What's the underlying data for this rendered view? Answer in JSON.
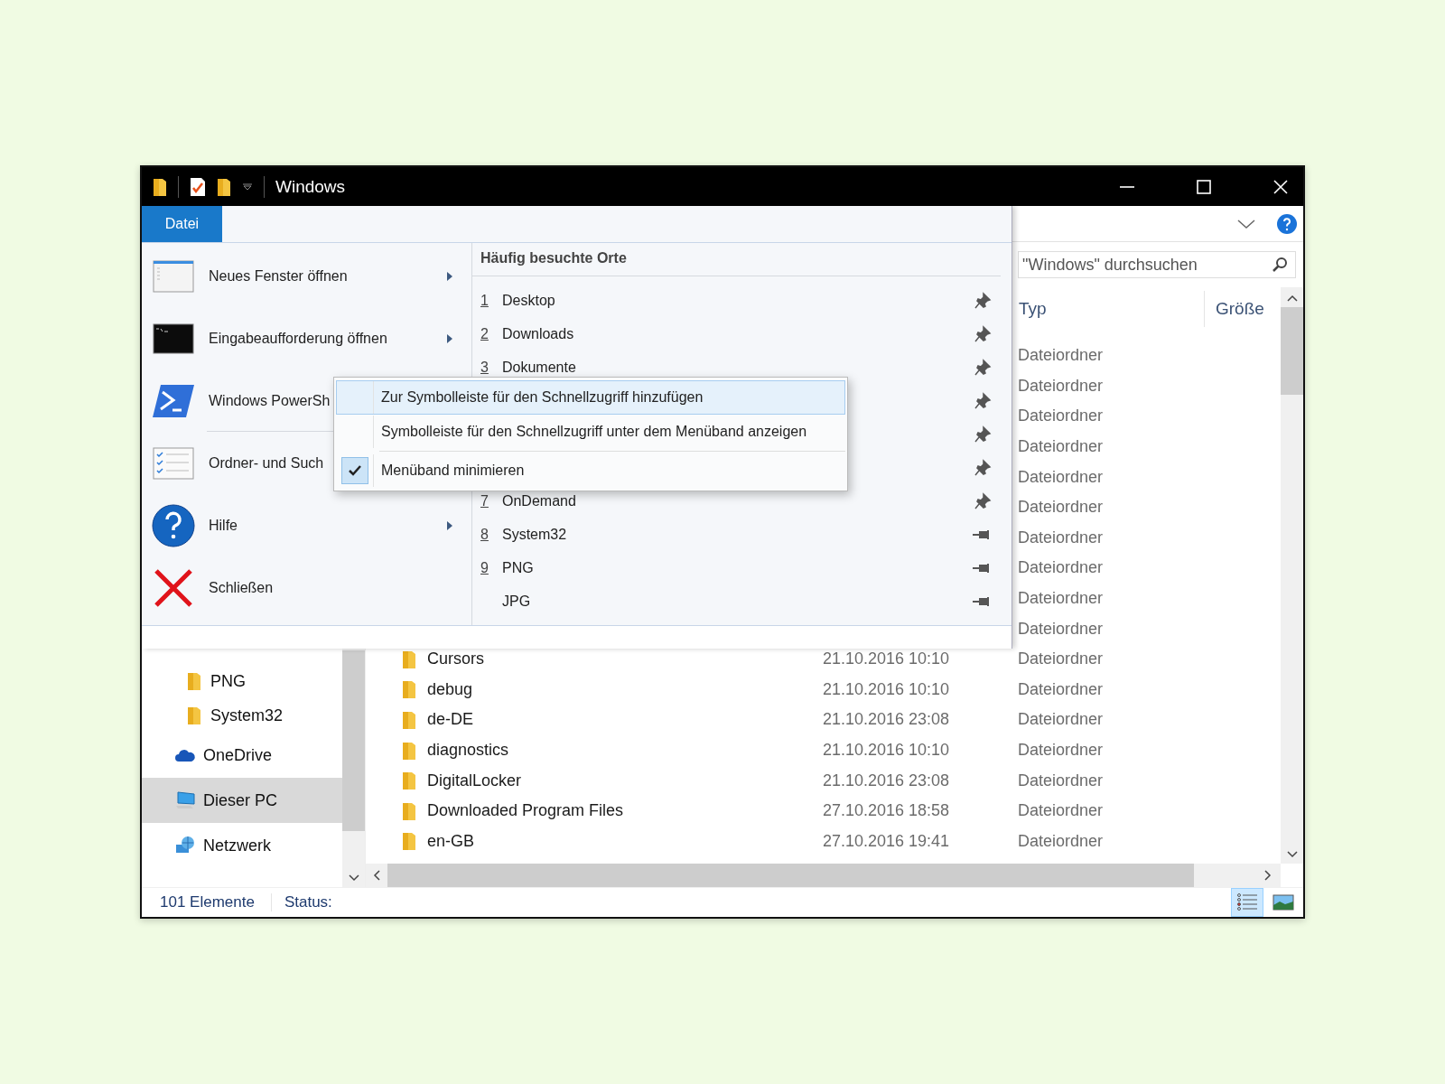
{
  "window": {
    "title": "Windows"
  },
  "search": {
    "placeholder": "\"Windows\" durchsuchen"
  },
  "file_menu": {
    "tab": "Datei",
    "commands": [
      {
        "label": "Neues Fenster öffnen",
        "submenu": true
      },
      {
        "label": "Eingabeaufforderung öffnen",
        "submenu": true
      },
      {
        "label": "Windows PowerSh",
        "submenu": false
      },
      {
        "label": "Ordner- und Such",
        "submenu": false
      },
      {
        "label": "Hilfe",
        "submenu": true
      },
      {
        "label": "Schließen",
        "submenu": false
      }
    ],
    "recent_title": "Häufig besuchte Orte",
    "recent_places": [
      {
        "number": "1",
        "name": "Desktop",
        "pinned": true
      },
      {
        "number": "2",
        "name": "Downloads",
        "pinned": true
      },
      {
        "number": "3",
        "name": "Dokumente",
        "pinned": true
      },
      {
        "pinned": true
      },
      {
        "pinned": true
      },
      {
        "pinned": true
      },
      {
        "number": "7",
        "name": "OnDemand",
        "pinned": true
      },
      {
        "number": "8",
        "name": "System32",
        "pinned": false
      },
      {
        "number": "9",
        "name": "PNG",
        "pinned": false
      },
      {
        "name": "JPG",
        "pinned": false
      }
    ]
  },
  "context_menu": {
    "items": [
      {
        "label": "Zur Symbolleiste für den Schnellzugriff hinzufügen",
        "selected": true,
        "checked": false
      },
      {
        "label": "Symbolleiste für den Schnellzugriff unter dem Menüband anzeigen",
        "selected": false,
        "checked": false
      },
      {
        "label": "Menüband minimieren",
        "selected": false,
        "checked": true
      }
    ]
  },
  "navigation": {
    "items": [
      {
        "kind": "folder",
        "label": "PNG",
        "selected": false
      },
      {
        "kind": "folder",
        "label": "System32",
        "selected": false
      },
      {
        "kind": "cloud",
        "label": "OneDrive",
        "selected": false
      },
      {
        "kind": "computer",
        "label": "Dieser PC",
        "selected": true
      },
      {
        "kind": "network",
        "label": "Netzwerk",
        "selected": false
      }
    ]
  },
  "columns": [
    {
      "label": "Typ"
    },
    {
      "label": "Größe"
    }
  ],
  "rows": [
    {
      "type": "Dateiordner"
    },
    {
      "type": "Dateiordner"
    },
    {
      "type": "Dateiordner"
    },
    {
      "type": "Dateiordner"
    },
    {
      "type": "Dateiordner"
    },
    {
      "type": "Dateiordner"
    },
    {
      "type": "Dateiordner"
    },
    {
      "type": "Dateiordner"
    },
    {
      "type": "Dateiordner"
    },
    {
      "type": "Dateiordner"
    },
    {
      "name": "Cursors",
      "date": "21.10.2016 10:10",
      "type": "Dateiordner"
    },
    {
      "name": "debug",
      "date": "21.10.2016 10:10",
      "type": "Dateiordner"
    },
    {
      "name": "de-DE",
      "date": "21.10.2016 23:08",
      "type": "Dateiordner"
    },
    {
      "name": "diagnostics",
      "date": "21.10.2016 10:10",
      "type": "Dateiordner"
    },
    {
      "name": "DigitalLocker",
      "date": "21.10.2016 23:08",
      "type": "Dateiordner"
    },
    {
      "name": "Downloaded Program Files",
      "date": "27.10.2016 18:58",
      "type": "Dateiordner"
    },
    {
      "name": "en-GB",
      "date": "27.10.2016 19:41",
      "type": "Dateiordner"
    }
  ],
  "status_bar": {
    "count": "101 Elemente",
    "status": "Status:"
  },
  "view_buttons": [
    {
      "kind": "details",
      "selected": true
    },
    {
      "kind": "large_icons",
      "selected": false
    }
  ]
}
